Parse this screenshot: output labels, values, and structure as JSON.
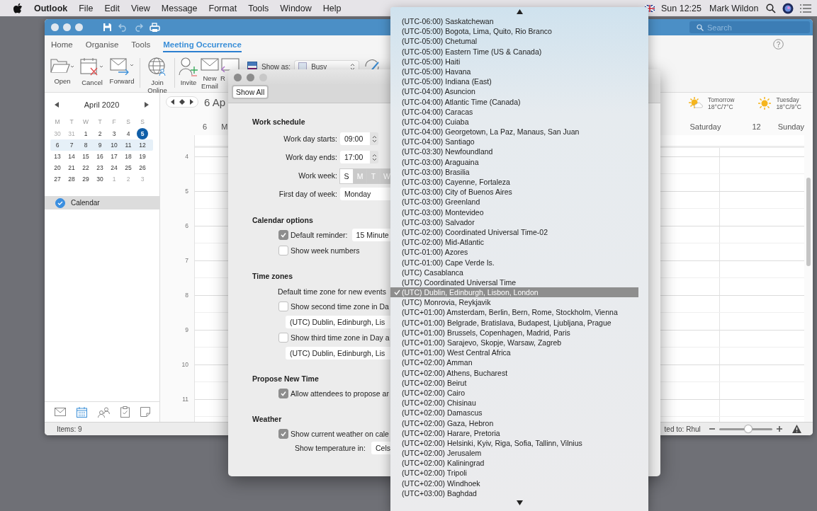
{
  "menu_bar": {
    "app": "Outlook",
    "menus": [
      "File",
      "Edit",
      "View",
      "Message",
      "Format",
      "Tools",
      "Window",
      "Help"
    ],
    "clock": "Sun 12:25",
    "user": "Mark Wildon"
  },
  "outlook": {
    "search": {
      "placeholder": "Search"
    },
    "tabs": [
      {
        "label": "Home",
        "selected": false
      },
      {
        "label": "Organise",
        "selected": false
      },
      {
        "label": "Tools",
        "selected": false
      },
      {
        "label": "Meeting Occurrence",
        "selected": true
      }
    ],
    "ribbon_groups": [
      {
        "buttons": [
          {
            "kind": "open",
            "label": "Open"
          },
          {
            "kind": "cancel",
            "label": "Cancel"
          },
          {
            "kind": "forward",
            "label": "Forward"
          }
        ]
      },
      {
        "buttons": [
          {
            "kind": "join",
            "label": "Join Online"
          }
        ]
      },
      {
        "buttons": [
          {
            "kind": "invite",
            "label": "Invite"
          },
          {
            "kind": "email",
            "label": "New Email"
          },
          {
            "kind": "reply",
            "label": "R"
          }
        ]
      }
    ],
    "show_as": {
      "label": "Show as:",
      "value": "Busy"
    },
    "mini_calendar": {
      "month": "April 2020",
      "weekdays": [
        "M",
        "T",
        "W",
        "T",
        "F",
        "S",
        "S"
      ],
      "weeks": [
        {
          "selected": false,
          "days": [
            {
              "day": "30",
              "outside": true,
              "today": false
            },
            {
              "day": "31",
              "outside": true,
              "today": false
            },
            {
              "day": "1",
              "outside": false,
              "today": false
            },
            {
              "day": "2",
              "outside": false,
              "today": false
            },
            {
              "day": "3",
              "outside": false,
              "today": false
            },
            {
              "day": "4",
              "outside": false,
              "today": false
            },
            {
              "day": "5",
              "outside": false,
              "today": true
            }
          ]
        },
        {
          "selected": true,
          "days": [
            {
              "day": "6",
              "outside": false,
              "today": false
            },
            {
              "day": "7",
              "outside": false,
              "today": false
            },
            {
              "day": "8",
              "outside": false,
              "today": false
            },
            {
              "day": "9",
              "outside": false,
              "today": false
            },
            {
              "day": "10",
              "outside": false,
              "today": false
            },
            {
              "day": "11",
              "outside": false,
              "today": false
            },
            {
              "day": "12",
              "outside": false,
              "today": false
            }
          ]
        },
        {
          "selected": false,
          "days": [
            {
              "day": "13",
              "outside": false,
              "today": false
            },
            {
              "day": "14",
              "outside": false,
              "today": false
            },
            {
              "day": "15",
              "outside": false,
              "today": false
            },
            {
              "day": "16",
              "outside": false,
              "today": false
            },
            {
              "day": "17",
              "outside": false,
              "today": false
            },
            {
              "day": "18",
              "outside": false,
              "today": false
            },
            {
              "day": "19",
              "outside": false,
              "today": false
            }
          ]
        },
        {
          "selected": false,
          "days": [
            {
              "day": "20",
              "outside": false,
              "today": false
            },
            {
              "day": "21",
              "outside": false,
              "today": false
            },
            {
              "day": "22",
              "outside": false,
              "today": false
            },
            {
              "day": "23",
              "outside": false,
              "today": false
            },
            {
              "day": "24",
              "outside": false,
              "today": false
            },
            {
              "day": "25",
              "outside": false,
              "today": false
            },
            {
              "day": "26",
              "outside": false,
              "today": false
            }
          ]
        },
        {
          "selected": false,
          "days": [
            {
              "day": "27",
              "outside": false,
              "today": false
            },
            {
              "day": "28",
              "outside": false,
              "today": false
            },
            {
              "day": "29",
              "outside": false,
              "today": false
            },
            {
              "day": "30",
              "outside": false,
              "today": false
            },
            {
              "day": "1",
              "outside": true,
              "today": false
            },
            {
              "day": "2",
              "outside": true,
              "today": false
            },
            {
              "day": "3",
              "outside": true,
              "today": false
            }
          ]
        }
      ]
    },
    "calendars": [
      {
        "name": "Calendar",
        "checked": true,
        "selected": true
      }
    ],
    "nav": [
      {
        "kind": "mail",
        "selected": false
      },
      {
        "kind": "calendar",
        "selected": true
      },
      {
        "kind": "people",
        "selected": false
      },
      {
        "kind": "tasks",
        "selected": false
      },
      {
        "kind": "notes",
        "selected": false
      }
    ],
    "calendar_view": {
      "title": "6 Ap",
      "left_day": {
        "number": "6",
        "name": "M"
      },
      "right_days": [
        {
          "name": "Saturday"
        },
        {
          "number": "12",
          "name": "Sunday"
        }
      ],
      "weather": [
        {
          "kind": "partly-cloudy",
          "day": "Tomorrow",
          "temps": "18°C/7°C"
        },
        {
          "kind": "sunny",
          "day": "Tuesday",
          "temps": "18°C/9°C"
        }
      ],
      "hours": [
        "4",
        "5",
        "6",
        "7",
        "8",
        "9",
        "10",
        "11"
      ]
    },
    "status": {
      "items": "Items: 9",
      "connection": "ted to: Rhul",
      "zoom": {
        "level": 0.55
      }
    }
  },
  "preferences": {
    "button": "Show All",
    "rows": [
      {
        "kind": "heading",
        "text": "Work schedule"
      },
      {
        "kind": "stepper",
        "label": "Work day starts:",
        "value": "09:00"
      },
      {
        "kind": "stepper",
        "label": "Work day ends:",
        "value": "17:00"
      },
      {
        "kind": "weekdays",
        "label": "Work week:",
        "days": [
          {
            "label": "S",
            "selected": false
          },
          {
            "label": "M",
            "selected": true
          },
          {
            "label": "T",
            "selected": true
          },
          {
            "label": "W",
            "selected": true
          }
        ]
      },
      {
        "kind": "select",
        "label": "First day of week:",
        "value": "Monday"
      },
      {
        "kind": "heading",
        "text": "Calendar options"
      },
      {
        "kind": "checkbox",
        "label": "Default reminder:",
        "checked": true,
        "value": "15 Minute"
      },
      {
        "kind": "checkbox",
        "label": "Show week numbers",
        "checked": false
      },
      {
        "kind": "heading",
        "text": "Time zones"
      },
      {
        "kind": "label",
        "text": "Default time zone for new events"
      },
      {
        "kind": "checkbox",
        "label": "Show second time zone in Da",
        "checked": false
      },
      {
        "kind": "popup",
        "value": "(UTC) Dublin, Edinburgh, Lis"
      },
      {
        "kind": "checkbox",
        "label": "Show third time zone in Day a",
        "checked": false
      },
      {
        "kind": "popup",
        "value": "(UTC) Dublin, Edinburgh, Lis"
      },
      {
        "kind": "heading",
        "text": "Propose New Time"
      },
      {
        "kind": "checkbox",
        "label": "Allow attendees to propose ar",
        "checked": true
      },
      {
        "kind": "heading",
        "text": "Weather"
      },
      {
        "kind": "checkbox",
        "label": "Show current weather on cale",
        "checked": true
      },
      {
        "kind": "inline_select",
        "label": "Show temperature in:",
        "value": "Cels"
      }
    ]
  },
  "timezone_menu": {
    "items": [
      {
        "label": "(UTC-06:00) Saskatchewan",
        "selected": false
      },
      {
        "label": "(UTC-05:00) Bogota, Lima, Quito, Rio Branco",
        "selected": false
      },
      {
        "label": "(UTC-05:00) Chetumal",
        "selected": false
      },
      {
        "label": "(UTC-05:00) Eastern Time (US & Canada)",
        "selected": false
      },
      {
        "label": "(UTC-05:00) Haiti",
        "selected": false
      },
      {
        "label": "(UTC-05:00) Havana",
        "selected": false
      },
      {
        "label": "(UTC-05:00) Indiana (East)",
        "selected": false
      },
      {
        "label": "(UTC-04:00) Asuncion",
        "selected": false
      },
      {
        "label": "(UTC-04:00) Atlantic Time (Canada)",
        "selected": false
      },
      {
        "label": "(UTC-04:00) Caracas",
        "selected": false
      },
      {
        "label": "(UTC-04:00) Cuiaba",
        "selected": false
      },
      {
        "label": "(UTC-04:00) Georgetown, La Paz, Manaus, San Juan",
        "selected": false
      },
      {
        "label": "(UTC-04:00) Santiago",
        "selected": false
      },
      {
        "label": "(UTC-03:30) Newfoundland",
        "selected": false
      },
      {
        "label": "(UTC-03:00) Araguaina",
        "selected": false
      },
      {
        "label": "(UTC-03:00) Brasilia",
        "selected": false
      },
      {
        "label": "(UTC-03:00) Cayenne, Fortaleza",
        "selected": false
      },
      {
        "label": "(UTC-03:00) City of Buenos Aires",
        "selected": false
      },
      {
        "label": "(UTC-03:00) Greenland",
        "selected": false
      },
      {
        "label": "(UTC-03:00) Montevideo",
        "selected": false
      },
      {
        "label": "(UTC-03:00) Salvador",
        "selected": false
      },
      {
        "label": "(UTC-02:00) Coordinated Universal Time-02",
        "selected": false
      },
      {
        "label": "(UTC-02:00) Mid-Atlantic",
        "selected": false
      },
      {
        "label": "(UTC-01:00) Azores",
        "selected": false
      },
      {
        "label": "(UTC-01:00) Cape Verde Is.",
        "selected": false
      },
      {
        "label": "(UTC) Casablanca",
        "selected": false
      },
      {
        "label": "(UTC) Coordinated Universal Time",
        "selected": false
      },
      {
        "label": "(UTC) Dublin, Edinburgh, Lisbon, London",
        "selected": true
      },
      {
        "label": "(UTC) Monrovia, Reykjavik",
        "selected": false
      },
      {
        "label": "(UTC+01:00) Amsterdam, Berlin, Bern, Rome, Stockholm, Vienna",
        "selected": false
      },
      {
        "label": "(UTC+01:00) Belgrade, Bratislava, Budapest, Ljubljana, Prague",
        "selected": false
      },
      {
        "label": "(UTC+01:00) Brussels, Copenhagen, Madrid, Paris",
        "selected": false
      },
      {
        "label": "(UTC+01:00) Sarajevo, Skopje, Warsaw, Zagreb",
        "selected": false
      },
      {
        "label": "(UTC+01:00) West Central Africa",
        "selected": false
      },
      {
        "label": "(UTC+02:00) Amman",
        "selected": false
      },
      {
        "label": "(UTC+02:00) Athens, Bucharest",
        "selected": false
      },
      {
        "label": "(UTC+02:00) Beirut",
        "selected": false
      },
      {
        "label": "(UTC+02:00) Cairo",
        "selected": false
      },
      {
        "label": "(UTC+02:00) Chisinau",
        "selected": false
      },
      {
        "label": "(UTC+02:00) Damascus",
        "selected": false
      },
      {
        "label": "(UTC+02:00) Gaza, Hebron",
        "selected": false
      },
      {
        "label": "(UTC+02:00) Harare, Pretoria",
        "selected": false
      },
      {
        "label": "(UTC+02:00) Helsinki, Kyiv, Riga, Sofia, Tallinn, Vilnius",
        "selected": false
      },
      {
        "label": "(UTC+02:00) Jerusalem",
        "selected": false
      },
      {
        "label": "(UTC+02:00) Kaliningrad",
        "selected": false
      },
      {
        "label": "(UTC+02:00) Tripoli",
        "selected": false
      },
      {
        "label": "(UTC+02:00) Windhoek",
        "selected": false
      },
      {
        "label": "(UTC+03:00) Baghdad",
        "selected": false
      }
    ]
  }
}
